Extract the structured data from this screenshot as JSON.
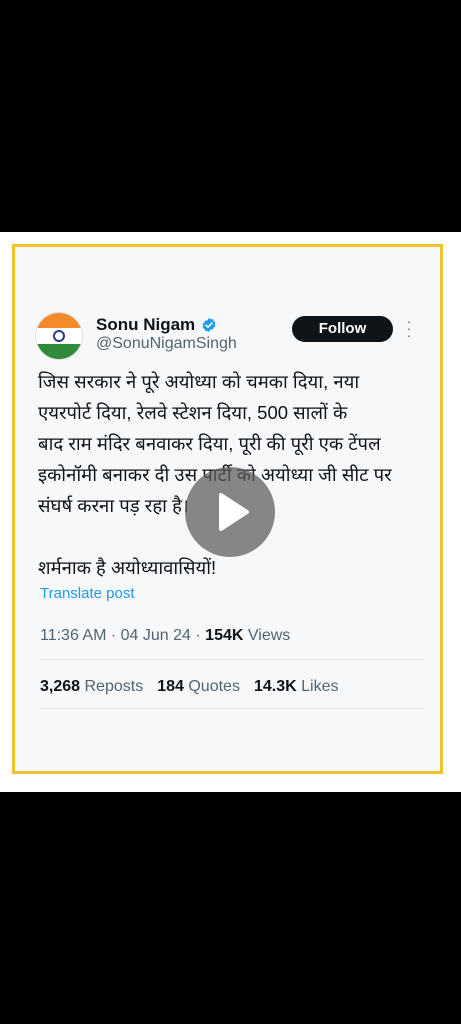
{
  "tweet": {
    "author_name": "Sonu Nigam",
    "handle": "@SonuNigamSingh",
    "follow_label": "Follow",
    "text": "जिस सरकार ने पूरे अयोध्या को चमका दिया, नया\nएयरपोर्ट दिया, रेलवे स्टेशन दिया, 500 सालों के\nबाद राम मंदिर बनवाकर दिया, पूरी की पूरी एक टेंपल\nइकोनॉमी बनाकर दी उस पार्टी को अयोध्या जी सीट पर\nसंघर्ष करना पड़ रहा है।\n\nशर्मनाक है अयोध्यावासियों!",
    "translate_label": "Translate post",
    "time": "11:36 AM",
    "date": "04 Jun 24",
    "views_count": "154K",
    "views_label": "Views",
    "reposts_count": "3,268",
    "reposts_label": "Reposts",
    "quotes_count": "184",
    "quotes_label": "Quotes",
    "likes_count": "14.3K",
    "likes_label": "Likes"
  },
  "colors": {
    "frame_border": "#f2c12e",
    "verified": "#1d9bf0",
    "link": "#1d9bf0"
  },
  "icons": [
    "verified-badge-icon",
    "more-options-icon",
    "play-icon"
  ]
}
